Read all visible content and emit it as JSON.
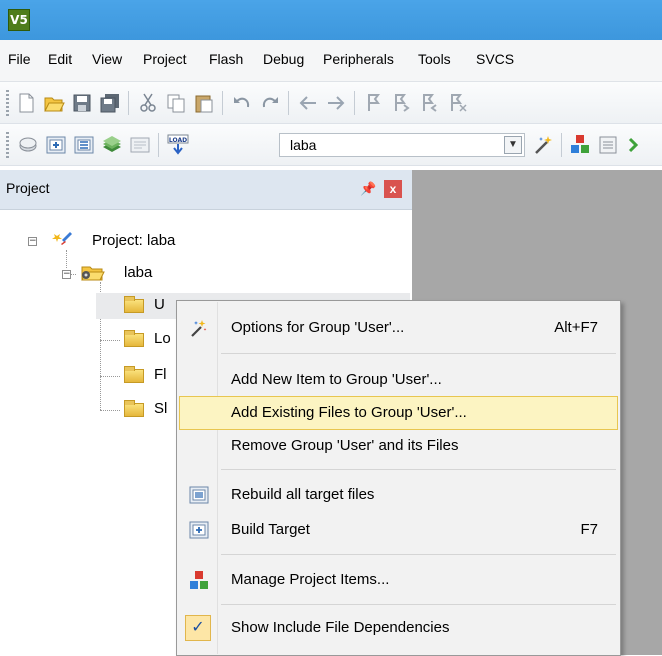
{
  "app": {
    "icon_text": "V5"
  },
  "menu": [
    "File",
    "Edit",
    "View",
    "Project",
    "Flash",
    "Debug",
    "Peripherals",
    "Tools",
    "SVCS"
  ],
  "toolbar": {
    "target_value": "laba"
  },
  "panel": {
    "title": "Project"
  },
  "tree": {
    "root": "Project: laba",
    "target": "laba",
    "groups": [
      "U",
      "Lo",
      "Fl",
      "Sl"
    ]
  },
  "context_menu": {
    "items": [
      {
        "label": "Options for Group 'User'...",
        "shortcut": "Alt+F7",
        "icon": "wand-icon"
      },
      {
        "label": "Add New  Item to Group 'User'...",
        "shortcut": ""
      },
      {
        "label": "Add Existing Files to Group 'User'...",
        "shortcut": "",
        "highlighted": true
      },
      {
        "label": "Remove Group 'User' and its Files",
        "shortcut": ""
      },
      {
        "label": "Rebuild all target files",
        "shortcut": "",
        "icon": "rebuild-icon"
      },
      {
        "label": "Build Target",
        "shortcut": "F7",
        "icon": "build-icon"
      },
      {
        "label": "Manage Project Items...",
        "shortcut": "",
        "icon": "manage-items-icon"
      },
      {
        "label": "Show Include File Dependencies",
        "shortcut": "",
        "checked": true
      }
    ],
    "check_glyph": "✓"
  },
  "colors": {
    "titlebar": "#3d97dd",
    "highlight": "#fcf4c2",
    "highlight_border": "#e8c650",
    "right_area": "#a7a7a7"
  }
}
